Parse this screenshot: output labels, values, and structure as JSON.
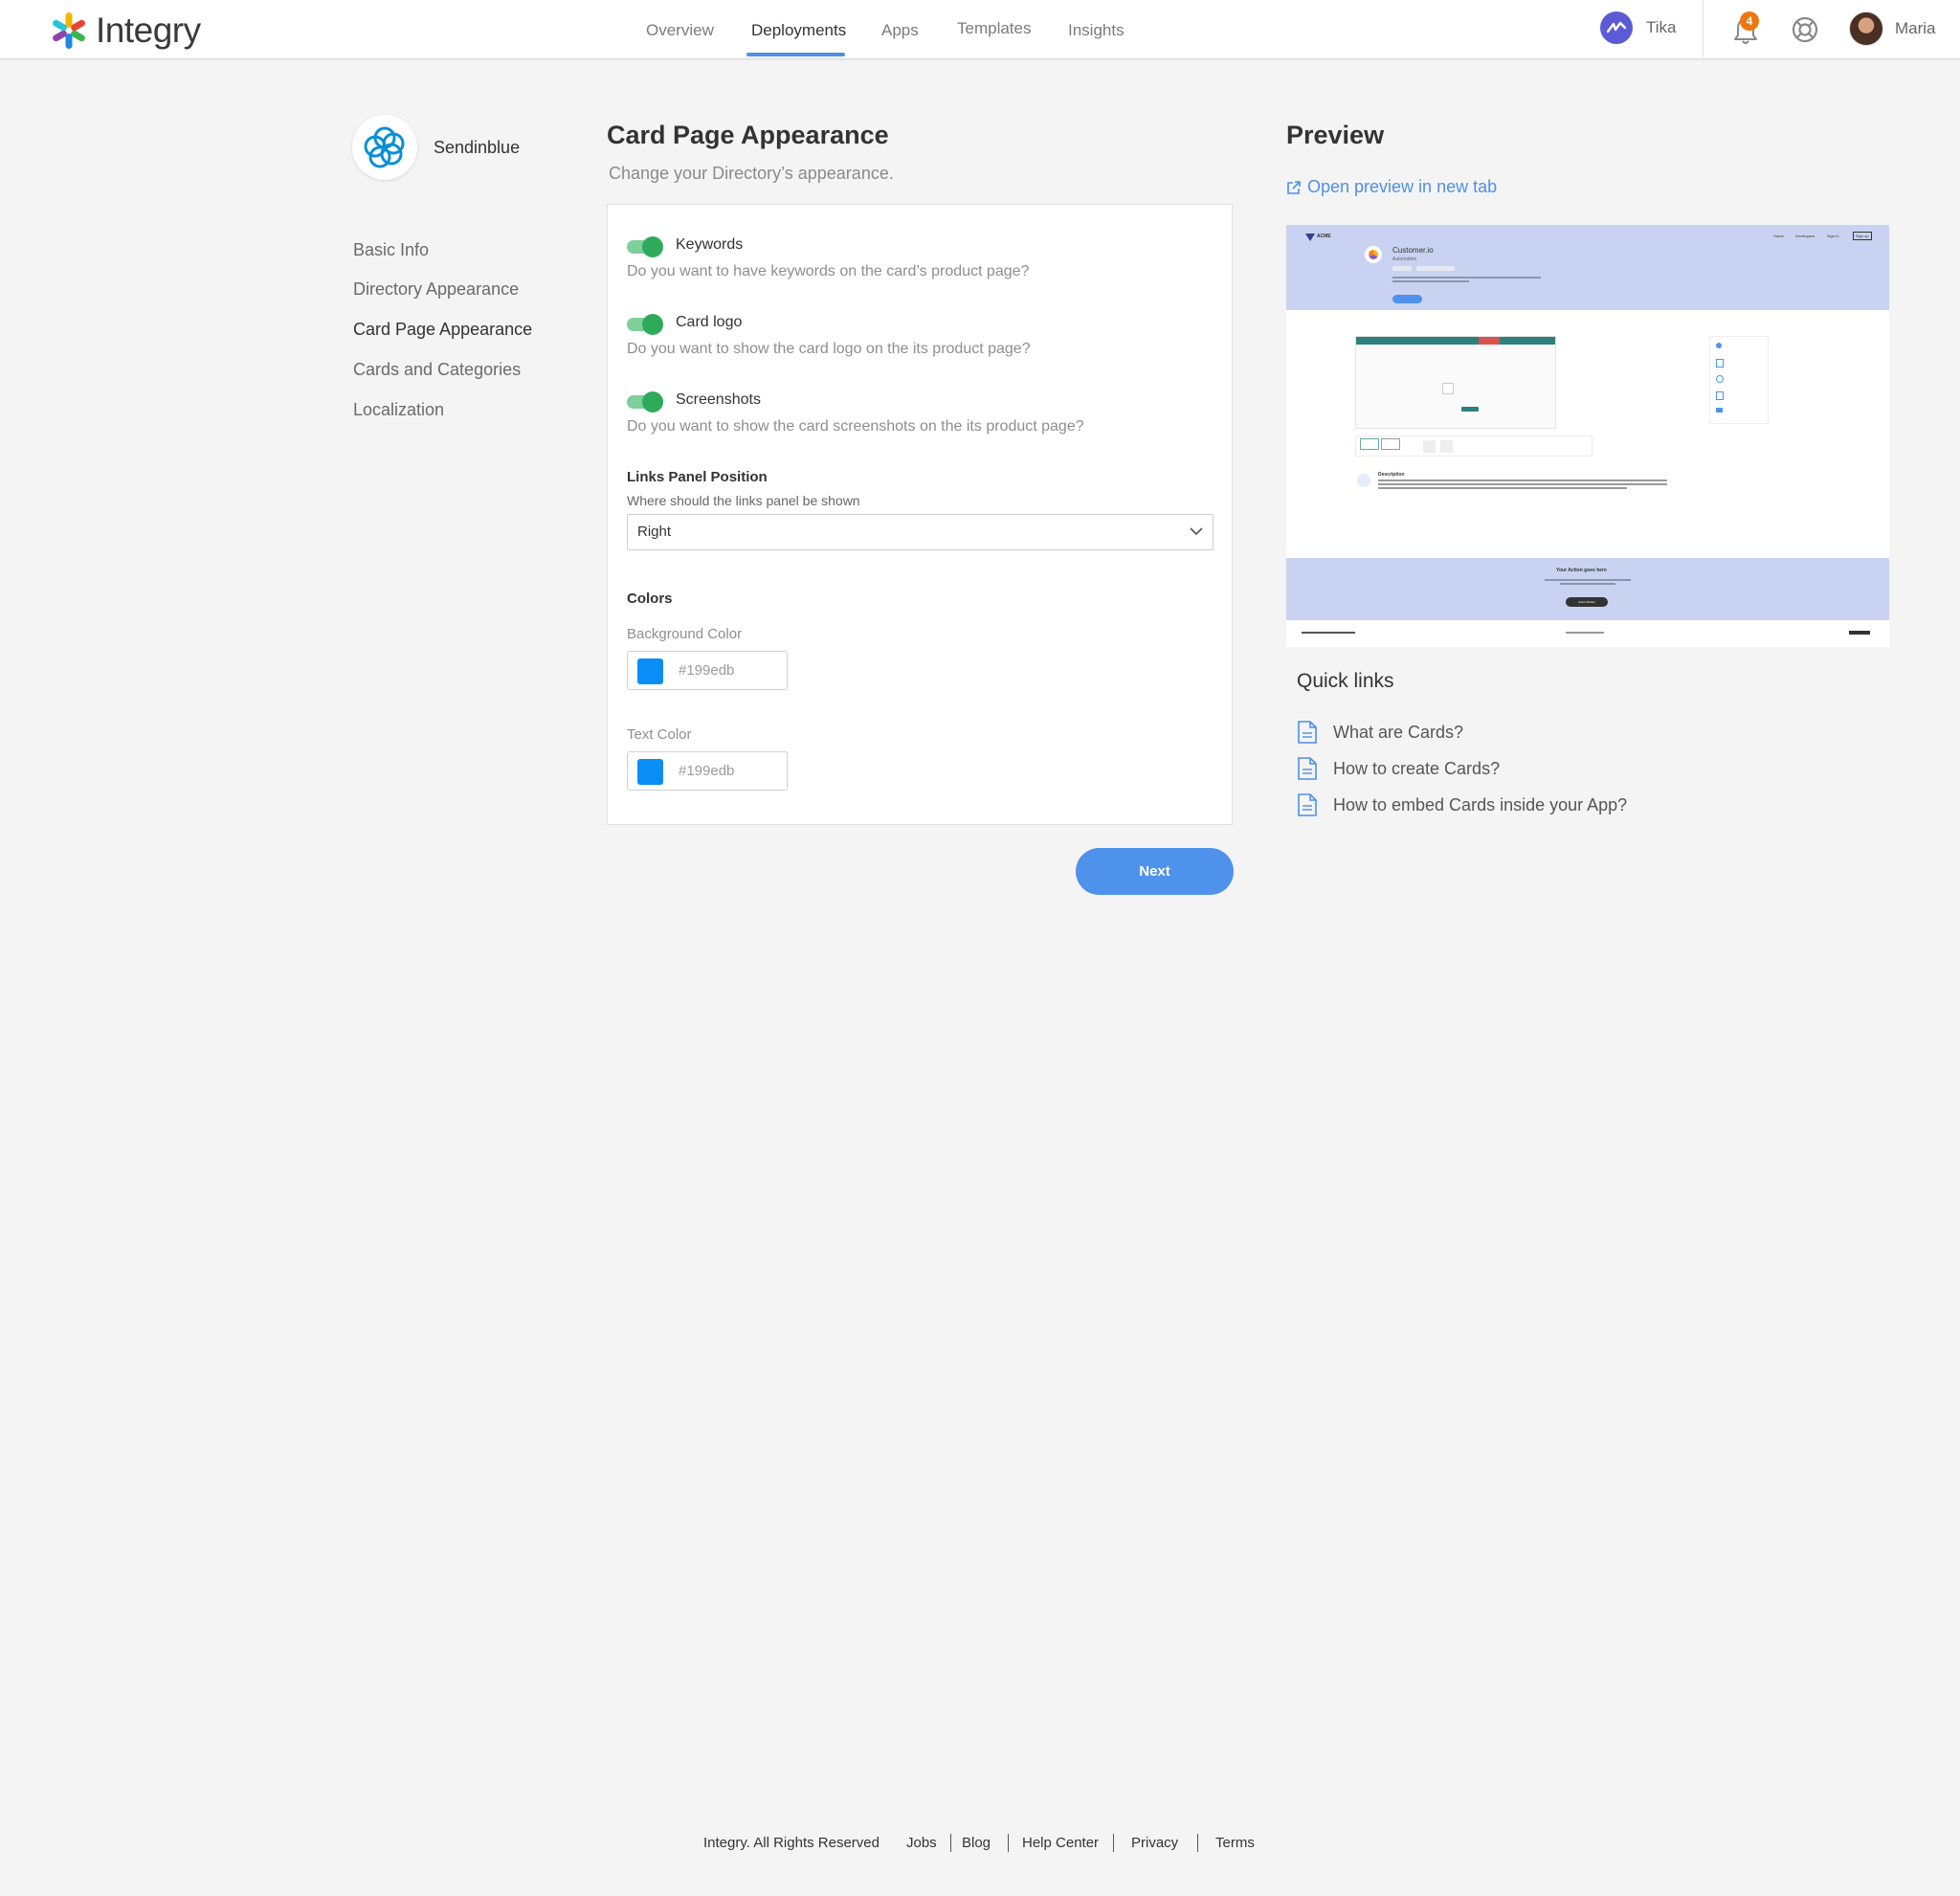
{
  "header": {
    "brand": "Integry",
    "nav": [
      {
        "label": "Overview"
      },
      {
        "label": "Deployments"
      },
      {
        "label": "Apps"
      },
      {
        "label": "Templates"
      },
      {
        "label": "Insights"
      }
    ],
    "active_nav": "Deployments",
    "workspace_name": "Tika",
    "notification_count": "4",
    "user_name": "Maria"
  },
  "sidebar": {
    "app_name": "Sendinblue",
    "items": [
      {
        "label": "Basic Info"
      },
      {
        "label": "Directory Appearance"
      },
      {
        "label": "Card Page Appearance"
      },
      {
        "label": "Cards and Categories"
      },
      {
        "label": "Localization"
      }
    ],
    "active_item": "Card Page Appearance"
  },
  "main": {
    "title": "Card Page Appearance",
    "subtitle": "Change your Directory’s appearance.",
    "toggles": [
      {
        "label": "Keywords",
        "description": "Do you want to have keywords on the card’s product page?",
        "on": true
      },
      {
        "label": "Card logo",
        "description": "Do you want to show the card logo on the its product page?",
        "on": true
      },
      {
        "label": "Screenshots",
        "description": "Do you want to show the card screenshots on the its product page?",
        "on": true
      }
    ],
    "links_panel": {
      "title": "Links Panel Position",
      "description": "Where should the links panel be shown",
      "value": "Right"
    },
    "colors": {
      "title": "Colors",
      "background_label": "Background Color",
      "background_value": "#199edb",
      "text_label": "Text Color",
      "text_value": "#199edb",
      "swatch_color": "#0a8ef5"
    },
    "next_label": "Next"
  },
  "preview": {
    "title": "Preview",
    "open_link": "Open preview in new tab",
    "mock": {
      "brand": "ACME",
      "nav": [
        "Home",
        "Developers",
        "Sign In",
        "Sign up"
      ],
      "app_name": "Customer.io",
      "app_category": "Automation",
      "description_heading": "Description",
      "action_heading": "Your Action goes here",
      "action_button": "Action Button"
    },
    "quick_links_title": "Quick links",
    "quick_links": [
      {
        "label": "What are Cards?"
      },
      {
        "label": "How to create Cards?"
      },
      {
        "label": "How to embed Cards inside your App?"
      }
    ]
  },
  "footer": {
    "copyright": "Integry. All Rights Reserved",
    "links": [
      "Jobs",
      "Blog",
      "Help Center",
      "Privacy",
      "Terms"
    ]
  },
  "colors": {
    "accent": "#4f8fe6",
    "toggle_on": "#2faa5b",
    "preview_band": "#c9d3f1",
    "badge": "#f0760c"
  }
}
